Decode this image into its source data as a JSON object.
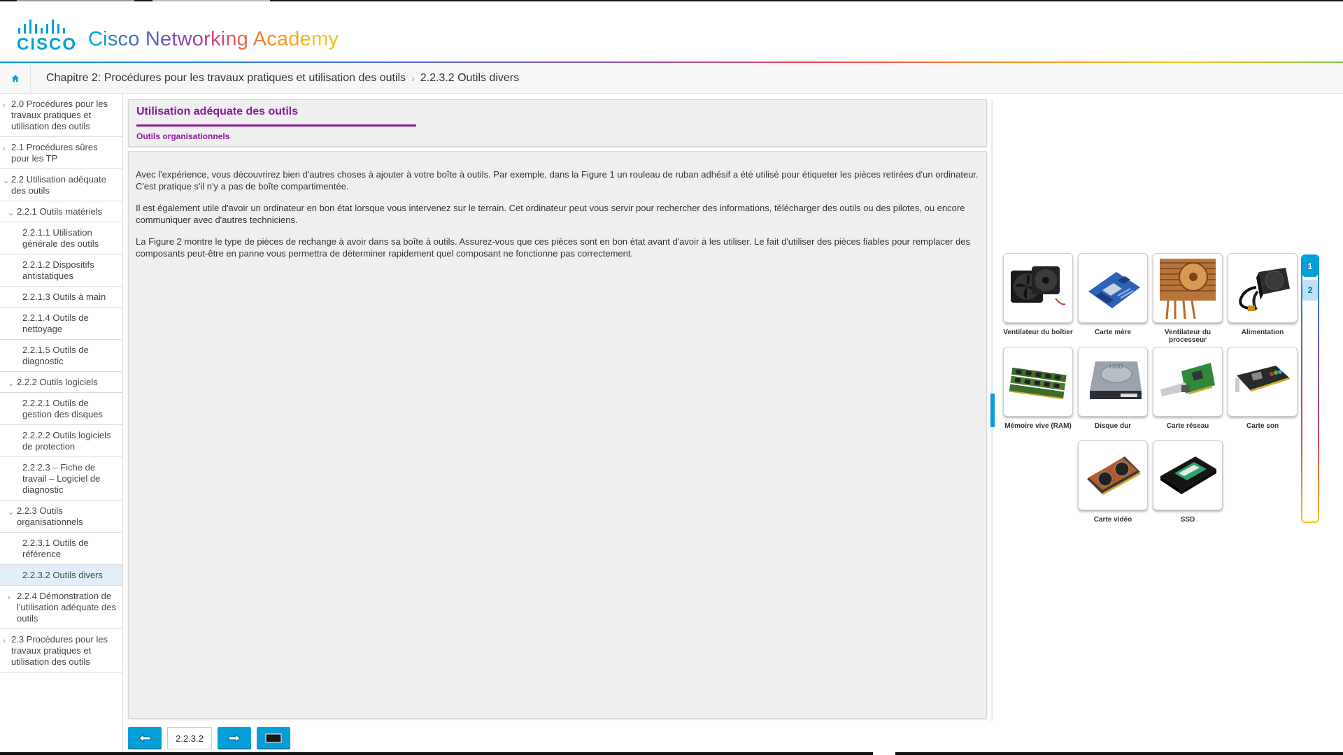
{
  "header": {
    "logo_text": "CISCO",
    "academy_title": "Cisco Networking Academy",
    "title_colors": [
      "#049fd9",
      "#0e98d6",
      "#2a86cf",
      "#3b76c7",
      "#4e69c0",
      "#5d60bb",
      "#6a56b6",
      "#7550b1",
      "#8d4aa8",
      "#a2469c",
      "#b8448e",
      "#cb4580",
      "#dd4871",
      "#e8525f",
      "#ee6649",
      "#f07a36",
      "#f28b2a",
      "#f39a24",
      "#f4a822",
      "#f5b520",
      "#f6c21f",
      "#e8c31f",
      "#cdc42a",
      "#b3c336"
    ]
  },
  "breadcrumb": {
    "chapter": "Chapitre 2: Procédures pour les travaux pratiques et utilisation des outils",
    "separator": "›",
    "current": "2.2.3.2 Outils divers"
  },
  "sidebar": {
    "items": [
      {
        "label": "2.0 Procédures pour les travaux pratiques et utilisation des outils"
      },
      {
        "label": "2.1 Procédures sûres pour les TP"
      },
      {
        "label": "2.2 Utilisation adéquate des outils"
      },
      {
        "label": "2.2.1 Outils matériels"
      },
      {
        "label": "2.2.1.1 Utilisation générale des outils"
      },
      {
        "label": "2.2.1.2 Dispositifs antistatiques"
      },
      {
        "label": "2.2.1.3 Outils à main"
      },
      {
        "label": "2.2.1.4 Outils de nettoyage"
      },
      {
        "label": "2.2.1.5 Outils de diagnostic"
      },
      {
        "label": "2.2.2 Outils logiciels"
      },
      {
        "label": "2.2.2.1 Outils de gestion des disques"
      },
      {
        "label": "2.2.2.2 Outils logiciels de protection"
      },
      {
        "label": "2.2.2.3 – Fiche de travail – Logiciel de diagnostic"
      },
      {
        "label": "2.2.3 Outils organisationnels"
      },
      {
        "label": "2.2.3.1 Outils de référence"
      },
      {
        "label": "2.2.3.2 Outils divers"
      },
      {
        "label": "2.2.4 Démonstration de l'utilisation adéquate des outils"
      },
      {
        "label": "2.3 Procédures pour les travaux pratiques et utilisation des outils"
      }
    ]
  },
  "content": {
    "title": "Utilisation adéquate des outils",
    "subtitle": "Outils organisationnels",
    "paragraphs": [
      "Avec l'expérience, vous découvrirez bien d'autres choses à ajouter à votre boîte à outils. Par exemple, dans la Figure 1 un rouleau de ruban adhésif a été utilisé pour étiqueter les pièces retirées d'un ordinateur. C'est pratique s'il n'y a pas de boîte compartimentée.",
      "Il est également utile d'avoir un ordinateur en bon état lorsque vous intervenez sur le terrain. Cet ordinateur peut vous servir pour rechercher des informations, télécharger des outils ou des pilotes, ou encore communiquer avec d'autres techniciens.",
      "La Figure 2 montre le type de pièces de rechange à avoir dans sa boîte à outils. Assurez-vous que ces pièces sont en bon état avant d'avoir à les utiliser. Le fait d'utiliser des pièces fiables pour remplacer des composants peut-être en panne vous permettra de déterminer rapidement quel composant ne fonctionne pas correctement."
    ]
  },
  "figure": {
    "parts": [
      {
        "label": "Ventilateur du boîtier",
        "icon": "case-fan-icon"
      },
      {
        "label": "Carte mère",
        "icon": "motherboard-icon"
      },
      {
        "label": "Ventilateur du processeur",
        "icon": "cpu-cooler-icon"
      },
      {
        "label": "Alimentation",
        "icon": "power-supply-icon"
      },
      {
        "label": "Mémoire vive (RAM)",
        "icon": "ram-icon"
      },
      {
        "label": "Disque dur",
        "icon": "hard-drive-icon"
      },
      {
        "label": "Carte réseau",
        "icon": "network-card-icon"
      },
      {
        "label": "Carte son",
        "icon": "sound-card-icon"
      },
      {
        "label": "Carte vidéo",
        "icon": "video-card-icon"
      },
      {
        "label": "SSD",
        "icon": "ssd-icon"
      }
    ],
    "tabs": [
      "1",
      "2"
    ],
    "active_tab": "1"
  },
  "bottom_nav": {
    "page": "2.2.3.2",
    "prev_icon": "arrow-left-icon",
    "next_icon": "arrow-right-icon",
    "toc_icon": "toc-icon"
  },
  "colors": {
    "accent": "#049fd9",
    "title_purple": "#8a1a9b",
    "active_nav": "#e2eef9"
  }
}
